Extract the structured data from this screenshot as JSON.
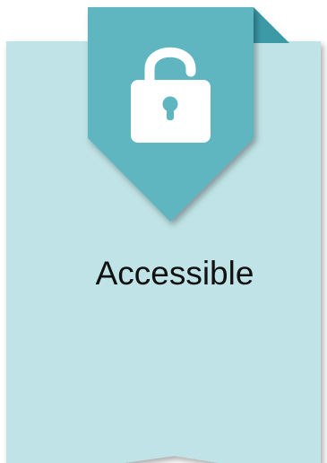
{
  "badge": {
    "label": "Accessible",
    "icon": "unlocked-padlock-icon",
    "colors": {
      "ribbon_body": "#bfe3e6",
      "tab": "#5fb6c0",
      "tab_fold": "#3b9aa6",
      "icon": "#ffffff",
      "label_text": "#111111"
    }
  }
}
